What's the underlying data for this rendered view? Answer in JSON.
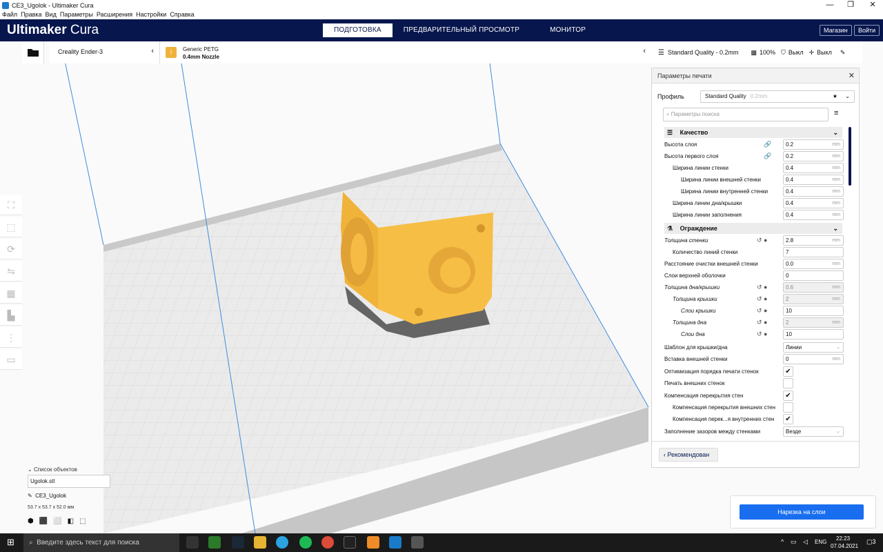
{
  "window": {
    "title": "CE3_Ugolok - Ultimaker Cura",
    "minimize": "—",
    "restore": "❐",
    "close": "✕"
  },
  "menu": [
    "Файл",
    "Правка",
    "Вид",
    "Параметры",
    "Расширения",
    "Настройки",
    "Справка"
  ],
  "header": {
    "logo_a": "Ultimaker",
    "logo_b": "Cura",
    "tabs": [
      {
        "label": "ПОДГОТОВКА",
        "active": true
      },
      {
        "label": "ПРЕДВАРИТЕЛЬНЫЙ ПРОСМОТР",
        "active": false
      },
      {
        "label": "МОНИТОР",
        "active": false
      }
    ],
    "marketplace": "Магазин",
    "signin": "Войти"
  },
  "printer": {
    "name": "Creality Ender-3",
    "material": "Generic PETG",
    "nozzle": "0.4mm Nozzle"
  },
  "settings_bar": {
    "profile": "Standard Quality - 0.2mm",
    "infill": "100%",
    "support": "Выкл",
    "adhesion": "Выкл"
  },
  "panel": {
    "title": "Параметры печати",
    "profile_label": "Профиль",
    "profile_value": "Standard Quality",
    "profile_sub": "0.2mm",
    "search_placeholder": "Параметры поиска",
    "recommended_btn": "Рекомендован",
    "categories": {
      "quality": "Качество",
      "walls": "Ограждение"
    },
    "rows": [
      {
        "label": "Высота слоя",
        "value": "0.2",
        "unit": "mm"
      },
      {
        "label": "Высота первого слоя",
        "value": "0.2",
        "unit": "mm"
      },
      {
        "label": "Ширина линии стенки",
        "value": "0.4",
        "unit": "mm"
      },
      {
        "label": "Ширина линии внешней стенки",
        "value": "0.4",
        "unit": "mm"
      },
      {
        "label": "Ширина линии внутренней стенки",
        "value": "0.4",
        "unit": "mm"
      },
      {
        "label": "Ширина линии дна/крышки",
        "value": "0.4",
        "unit": "mm"
      },
      {
        "label": "Ширина линии заполнения",
        "value": "0.4",
        "unit": "mm"
      },
      {
        "label": "Толщина стенки",
        "value": "2.8",
        "unit": "mm"
      },
      {
        "label": "Количество линий стенки",
        "value": "7",
        "unit": ""
      },
      {
        "label": "Расстояние очистки внешней стенки",
        "value": "0.0",
        "unit": "mm"
      },
      {
        "label": "Слои верхней оболочки",
        "value": "0",
        "unit": ""
      },
      {
        "label": "Толщина дна/крышки",
        "value": "0.6",
        "unit": "mm"
      },
      {
        "label": "Толщина крышки",
        "value": "2",
        "unit": "mm"
      },
      {
        "label": "Слои крышки",
        "value": "10",
        "unit": ""
      },
      {
        "label": "Толщина дна",
        "value": "2",
        "unit": "mm"
      },
      {
        "label": "Слои дна",
        "value": "10",
        "unit": ""
      },
      {
        "label": "Шаблон для крышки/дна",
        "value": "Линии",
        "unit": ""
      },
      {
        "label": "Вставка внешней стенки",
        "value": "0",
        "unit": "mm"
      },
      {
        "label": "Оптимизация порядка печати стенок",
        "value": "✔",
        "unit": ""
      },
      {
        "label": "Печать внешних стенок",
        "value": "",
        "unit": ""
      },
      {
        "label": "Компенсация перекрытия стен",
        "value": "✔",
        "unit": ""
      },
      {
        "label": "Компенсация перекрытия внешних стен",
        "value": "",
        "unit": ""
      },
      {
        "label": "Компенсация перек...я внутренних стен",
        "value": "✔",
        "unit": ""
      },
      {
        "label": "Заполнение зазоров между стенками",
        "value": "Везде",
        "unit": ""
      }
    ]
  },
  "objects": {
    "header": "Список объектов",
    "file": "Ugolok.stl",
    "job": "CE3_Ugolok",
    "dims": "53.7 x 53.7 x 52.0 мм"
  },
  "slice_btn": "Нарезка на слои",
  "taskbar": {
    "search": "Введите здесь текст для поиска",
    "lang": "ENG",
    "time": "22:23",
    "date": "07.04.2021",
    "notif": "3"
  }
}
